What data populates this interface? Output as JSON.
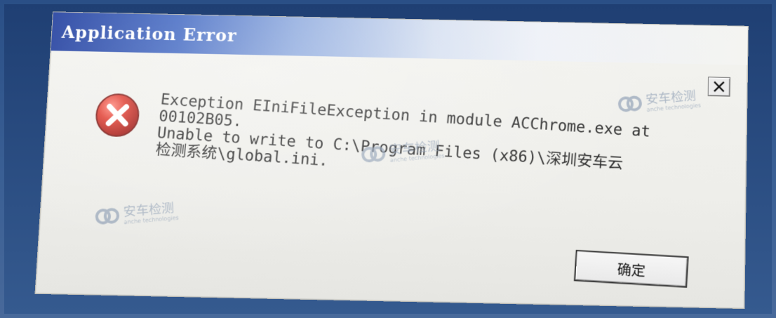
{
  "dialog": {
    "title": "Application Error",
    "message_lines": [
      "Exception EIniFileException in module ACChrome.exe at",
      "00102B05.",
      "Unable to write to C:\\Program Files (x86)\\深圳安车云",
      "检测系统\\global.ini."
    ],
    "ok_label": "确定"
  },
  "watermark": {
    "brand": "安车检测",
    "subtitle": "anche technologies"
  },
  "colors": {
    "title_gradient_start": "#1c3a9c",
    "title_gradient_end": "#f4f4f1",
    "dialog_bg": "#f0f0ec",
    "error_red": "#d43a2f"
  },
  "icons": {
    "error": "error-x-icon",
    "close": "close-x-icon"
  }
}
